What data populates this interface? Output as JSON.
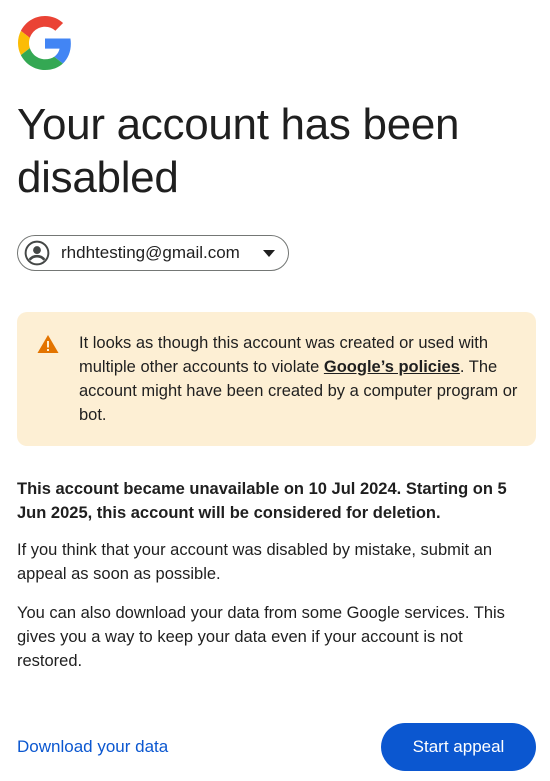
{
  "heading": {
    "title": "Your account has been disabled"
  },
  "account": {
    "email": "rhdhtesting@gmail.com"
  },
  "warning": {
    "text_before_link": "It looks as though this account was created or used with multiple other accounts to violate ",
    "link_text": "Google’s policies",
    "text_after_link": ". The account might have been created by a computer program or bot."
  },
  "body": {
    "notice": "This account became unavailable on 10 Jul 2024. Starting on 5 Jun 2025, this account will be considered for deletion.",
    "paragraph_1": "If you think that your account was disabled by mistake, submit an appeal as soon as possible.",
    "paragraph_2": "You can also download your data from some Google services. This gives you a way to keep your data even if your account is not restored."
  },
  "actions": {
    "download_label": "Download your data",
    "appeal_label": "Start appeal"
  },
  "icons": {
    "logo": "google-logo-icon",
    "avatar": "account-circle-icon",
    "dropdown": "chevron-down-icon",
    "warning": "warning-triangle-icon"
  },
  "colors": {
    "primary": "#0b57d0",
    "warning_bg": "#fdefd4",
    "warning_icon": "#e37400",
    "text": "#1f1f1f",
    "google_blue": "#4285f4",
    "google_red": "#ea4335",
    "google_yellow": "#fbbc05",
    "google_green": "#34a853"
  }
}
